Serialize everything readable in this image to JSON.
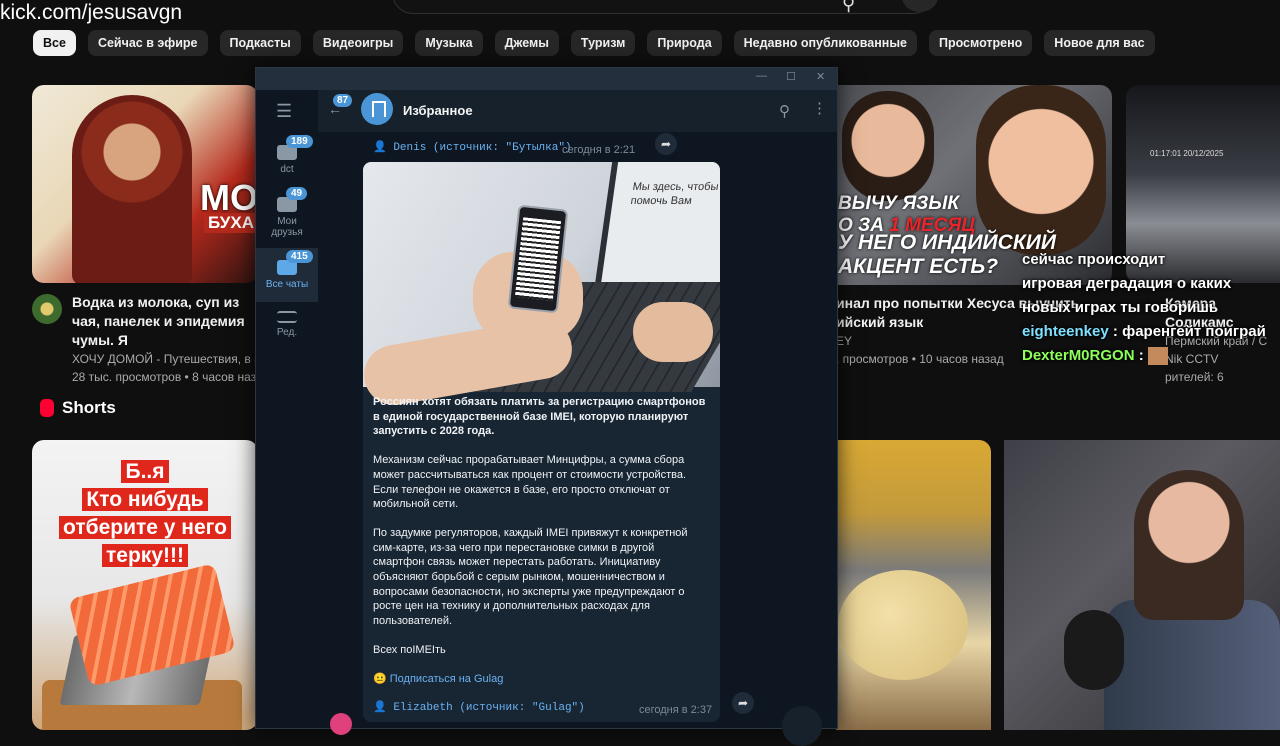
{
  "overlay": {
    "stream_url": "kick.com/jesusavgn"
  },
  "youtube": {
    "chips": [
      "Все",
      "Сейчас в эфире",
      "Подкасты",
      "Видеоигры",
      "Музыка",
      "Джемы",
      "Туризм",
      "Природа",
      "Недавно опубликованные",
      "Просмотрено",
      "Новое для вас"
    ],
    "video1": {
      "thumb_text": "МОН",
      "thumb_text2": "БУХАРИ",
      "title": "Водка из молока, суп из чая, панелек и эпидемия чумы. Я",
      "channel": "ХОЧУ ДОМОЙ - Путешествия, в ко",
      "meta": "28 тыс. просмотров • 8 часов наз"
    },
    "video2": {
      "thumb_line1": "ВЫЧУ ЯЗЫК",
      "thumb_line1b": "О ЗА",
      "thumb_line1c": "1 МЕСЯЦ",
      "thumb_line2": "У НЕГО ИНДИЙСКИЙ",
      "thumb_line3": "АКЦЕНТ ЕСТЬ?",
      "title1": "инал про попытки Хесуса выучить",
      "title2": "ийский язык",
      "channel": "EY",
      "meta": ". просмотров • 10 часов назад"
    },
    "video3": {
      "title1": "Камера Соликамс",
      "title2": "Пермский край / С",
      "channel": "Nik CCTV",
      "meta": "рителей: 6",
      "cam_timestamp": "01:17:01 20/12/2025"
    },
    "shorts": {
      "heading": "Shorts",
      "short1_lines": [
        "Б..я",
        "Кто нибудь",
        "отберите у него",
        "терку!!!"
      ]
    }
  },
  "stream_chat": [
    {
      "user": "",
      "text": "сейчас происходит"
    },
    {
      "user": "",
      "text": "игровая деградация о каких"
    },
    {
      "user": "",
      "text": "новых играх ты говоришь"
    },
    {
      "user": "eighteenkey",
      "text": "фаренгейт поиграй"
    },
    {
      "user": "DexterM0RGON",
      "text": ""
    }
  ],
  "telegram": {
    "title": "Избранное",
    "back_badge": "87",
    "folders": [
      {
        "label": "dct",
        "badge": "189"
      },
      {
        "label": "Мои друзья",
        "badge": "49"
      },
      {
        "label": "Все чаты",
        "badge": "415"
      },
      {
        "label": "Ред.",
        "badge": ""
      }
    ],
    "top_forward": {
      "from": "Denis (источник: \"Бутылка\")",
      "time": "сегодня в 2:21"
    },
    "image_screen_text": "Мы здесь, чтобы помочь Вам",
    "message": {
      "headline": "Россиян хотят обязать платить за регистрацию смартфонов в единой государственной базе IMEI, которую планируют запустить с 2028 года.",
      "p1": "Механизм сейчас прорабатывает Минцифры, а сумма сбора может рассчитываться как процент от стоимости устройства. Если телефон не окажется в базе, его просто отключат от мобильной сети.",
      "p2": "По задумке регуляторов, каждый IMEI привяжут к конкретной сим-карте, из-за чего при перестановке симки в другой смартфон связь может перестать работать. Инициативу объясняют борьбой с серым рынком, мошенничеством и вопросами безопасности, но эксперты уже предупреждают о росте цен на технику и дополнительных расходах для пользователей.",
      "p3": "Всех поIMEIть",
      "link_emoji": "😐",
      "link": "Подписаться на Gulag"
    },
    "bottom_forward": {
      "from": "Elizabeth (источник: \"Gulag\")",
      "time": "сегодня в 2:37"
    }
  }
}
